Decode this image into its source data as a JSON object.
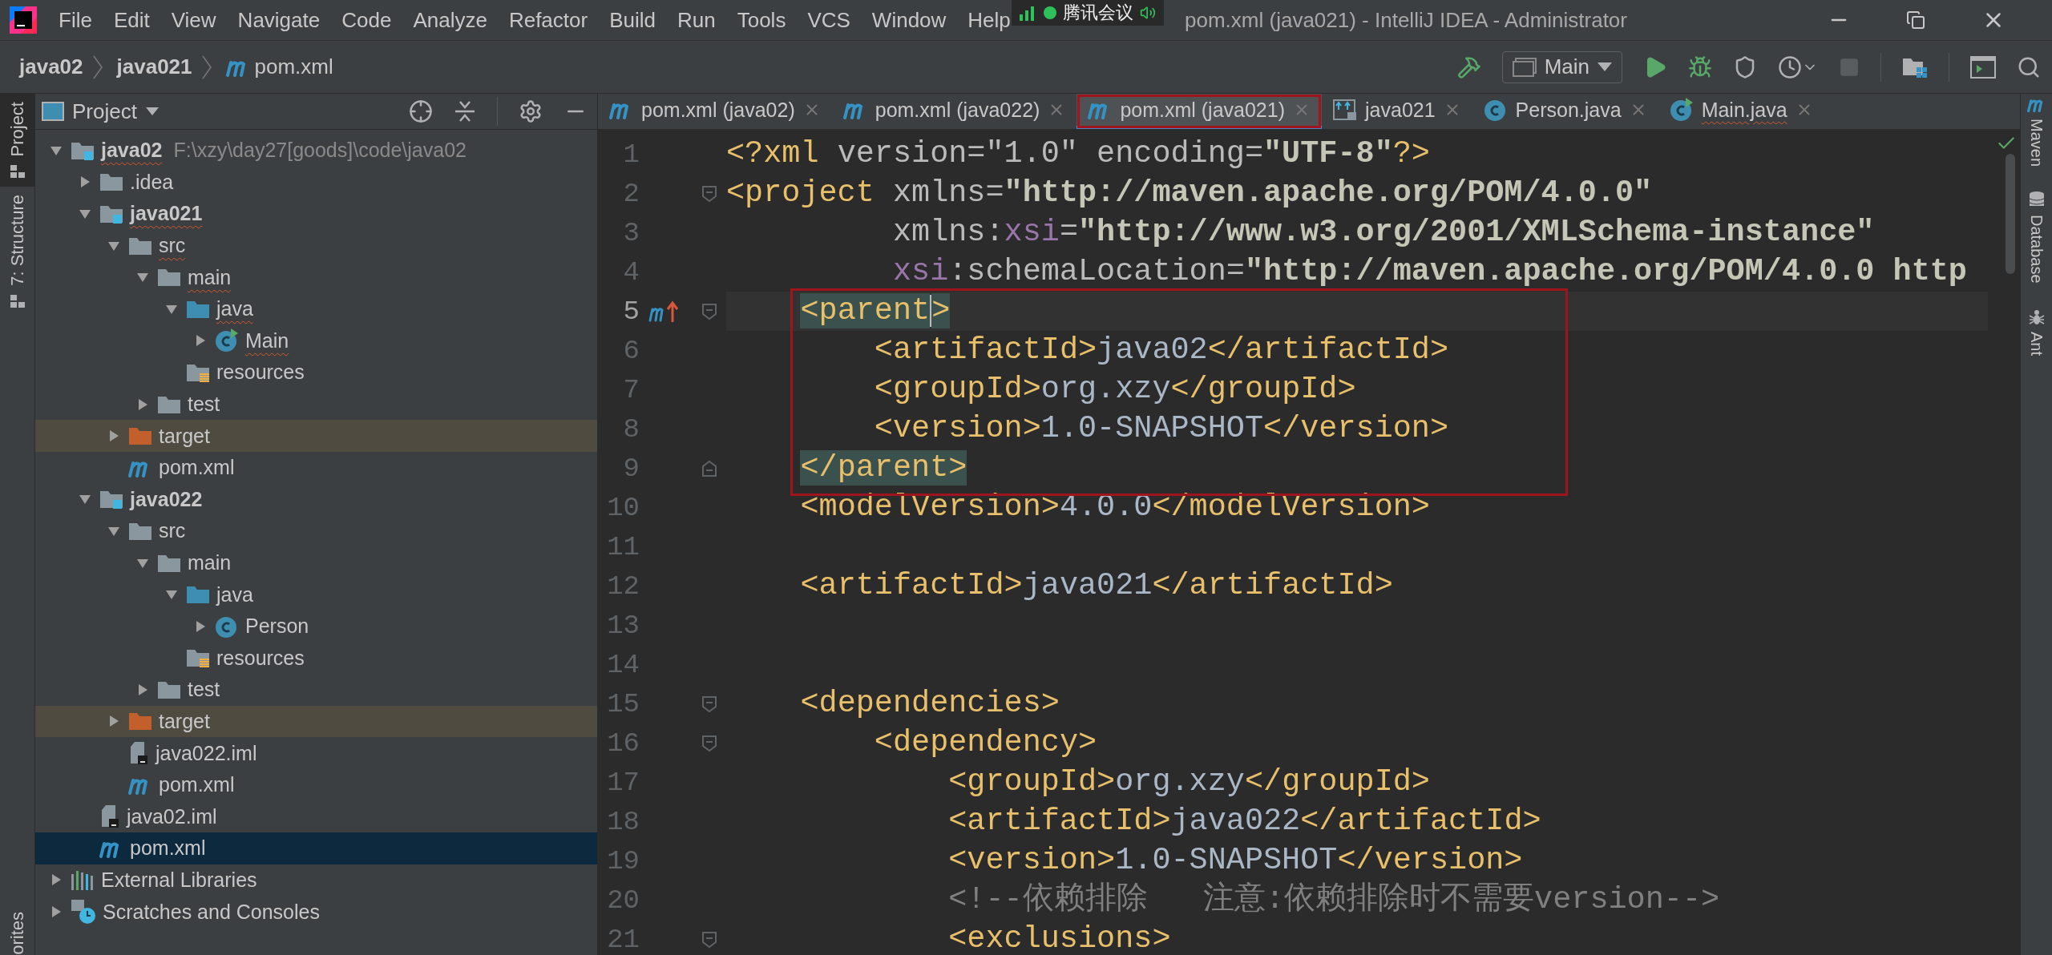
{
  "title_bar": {
    "menu": [
      "File",
      "Edit",
      "View",
      "Navigate",
      "Code",
      "Analyze",
      "Refactor",
      "Build",
      "Run",
      "Tools",
      "VCS",
      "Window",
      "Help"
    ],
    "title": "pom.xml (java021) - IntelliJ IDEA - Administrator"
  },
  "meeting_overlay": {
    "label": "腾讯会议"
  },
  "breadcrumbs": [
    {
      "label": "java02",
      "kind": "module"
    },
    {
      "label": "java021",
      "kind": "module"
    },
    {
      "label": "pom.xml",
      "kind": "maven"
    }
  ],
  "run_config": {
    "label": "Main"
  },
  "left_stripe": {
    "top": [
      {
        "label": "Project",
        "selected": true
      },
      {
        "label": "7: Structure",
        "selected": false
      }
    ],
    "bottom": [
      {
        "label": "orites",
        "selected": false
      }
    ]
  },
  "project_panel": {
    "title": "Project",
    "tree": [
      {
        "label": "java02",
        "kind": "module",
        "location": "F:\\xzy\\day27[goods]\\code\\java02",
        "expanded": true,
        "selected": false,
        "error": true,
        "children": [
          {
            "label": ".idea",
            "kind": "folder",
            "expanded": false,
            "selected": false,
            "error": false
          },
          {
            "label": "java021",
            "kind": "module",
            "expanded": true,
            "selected": false,
            "error": true,
            "children": [
              {
                "label": "src",
                "kind": "folder",
                "expanded": true,
                "selected": false,
                "error": true,
                "children": [
                  {
                    "label": "main",
                    "kind": "folder",
                    "expanded": true,
                    "selected": false,
                    "error": true,
                    "children": [
                      {
                        "label": "java",
                        "kind": "source",
                        "expanded": true,
                        "selected": false,
                        "error": true,
                        "children": [
                          {
                            "label": "Main",
                            "kind": "class-main",
                            "expanded": false,
                            "selected": false,
                            "error": true
                          }
                        ]
                      },
                      {
                        "label": "resources",
                        "kind": "resources",
                        "selected": false,
                        "error": false
                      }
                    ]
                  },
                  {
                    "label": "test",
                    "kind": "folder",
                    "expanded": false,
                    "selected": false,
                    "error": false
                  }
                ]
              },
              {
                "label": "target",
                "kind": "excluded",
                "expanded": false,
                "selected": false,
                "error": false
              },
              {
                "label": "pom.xml",
                "kind": "maven",
                "selected": false,
                "error": false
              }
            ]
          },
          {
            "label": "java022",
            "kind": "module",
            "expanded": true,
            "selected": false,
            "error": false,
            "children": [
              {
                "label": "src",
                "kind": "folder",
                "expanded": true,
                "selected": false,
                "error": false,
                "children": [
                  {
                    "label": "main",
                    "kind": "folder",
                    "expanded": true,
                    "selected": false,
                    "error": false,
                    "children": [
                      {
                        "label": "java",
                        "kind": "source",
                        "expanded": true,
                        "selected": false,
                        "error": false,
                        "children": [
                          {
                            "label": "Person",
                            "kind": "class",
                            "expanded": false,
                            "selected": false,
                            "error": false
                          }
                        ]
                      },
                      {
                        "label": "resources",
                        "kind": "resources",
                        "selected": false,
                        "error": false
                      }
                    ]
                  },
                  {
                    "label": "test",
                    "kind": "folder",
                    "expanded": false,
                    "selected": false,
                    "error": false
                  }
                ]
              },
              {
                "label": "target",
                "kind": "excluded",
                "expanded": false,
                "selected": false,
                "error": false
              },
              {
                "label": "java022.iml",
                "kind": "iml",
                "selected": false,
                "error": false
              },
              {
                "label": "pom.xml",
                "kind": "maven",
                "selected": false,
                "error": false
              }
            ]
          },
          {
            "label": "java02.iml",
            "kind": "iml",
            "selected": false,
            "error": false
          },
          {
            "label": "pom.xml",
            "kind": "maven",
            "selected": true,
            "error": false
          }
        ]
      },
      {
        "label": "External Libraries",
        "kind": "libraries",
        "expanded": false,
        "selected": false,
        "error": false
      },
      {
        "label": "Scratches and Consoles",
        "kind": "scratches",
        "expanded": false,
        "selected": false,
        "error": false
      }
    ]
  },
  "editor": {
    "tabs": [
      {
        "label": "pom.xml (java02)",
        "kind": "maven",
        "selected": false,
        "annotated": false,
        "error": false
      },
      {
        "label": "pom.xml (java022)",
        "kind": "maven",
        "selected": false,
        "annotated": false,
        "error": false
      },
      {
        "label": "pom.xml (java021)",
        "kind": "maven",
        "selected": true,
        "annotated": true,
        "error": false
      },
      {
        "label": "java021",
        "kind": "module",
        "selected": false,
        "annotated": false,
        "error": false
      },
      {
        "label": "Person.java",
        "kind": "class",
        "selected": false,
        "annotated": false,
        "error": false
      },
      {
        "label": "Main.java",
        "kind": "class-main",
        "selected": false,
        "annotated": false,
        "error": true
      }
    ],
    "lines": [
      {
        "number": "1",
        "current": false,
        "boxed": false,
        "tokens": [
          {
            "kind": "tag",
            "t": "<?xml "
          },
          {
            "kind": "attr",
            "t": "version=\"1.0\" encoding="
          },
          {
            "kind": "value",
            "t": "\"UTF-8\""
          },
          {
            "kind": "tag",
            "t": "?>"
          }
        ]
      },
      {
        "number": "2",
        "current": false,
        "boxed": false,
        "fold_start": true,
        "tokens": [
          {
            "kind": "tag",
            "t": "<project "
          },
          {
            "kind": "attr",
            "t": "xmlns="
          },
          {
            "kind": "value",
            "t": "\"http://maven.apache.org/POM/4.0.0\""
          }
        ]
      },
      {
        "number": "3",
        "current": false,
        "boxed": false,
        "tokens": [
          {
            "kind": "attr",
            "t": "         xmlns:"
          },
          {
            "kind": "ns",
            "t": "xsi"
          },
          {
            "kind": "attr",
            "t": "="
          },
          {
            "kind": "value",
            "t": "\"http://www.w3.org/2001/XMLSchema-instance\""
          }
        ]
      },
      {
        "number": "4",
        "current": false,
        "boxed": false,
        "tokens": [
          {
            "kind": "ns",
            "t": "         xsi"
          },
          {
            "kind": "attr",
            "t": ":schemaLocation="
          },
          {
            "kind": "value",
            "t": "\"http://maven.apache.org/POM/4.0.0 http"
          }
        ]
      },
      {
        "number": "5",
        "current": true,
        "boxed": true,
        "fold_start": true,
        "maven_override": true,
        "tokens": [
          {
            "kind": "match",
            "t": "    <parent"
          },
          {
            "kind": "caret"
          },
          {
            "kind": "match",
            "t": ">"
          }
        ]
      },
      {
        "number": "6",
        "current": false,
        "boxed": true,
        "tokens": [
          {
            "kind": "tag",
            "t": "        <artifactId>"
          },
          {
            "kind": "text",
            "t": "java02"
          },
          {
            "kind": "tag",
            "t": "</artifactId>"
          }
        ]
      },
      {
        "number": "7",
        "current": false,
        "boxed": true,
        "tokens": [
          {
            "kind": "tag",
            "t": "        <groupId>"
          },
          {
            "kind": "text",
            "t": "org.xzy"
          },
          {
            "kind": "tag",
            "t": "</groupId>"
          }
        ]
      },
      {
        "number": "8",
        "current": false,
        "boxed": true,
        "tokens": [
          {
            "kind": "tag",
            "t": "        <version>"
          },
          {
            "kind": "text",
            "t": "1.0-SNAPSHOT"
          },
          {
            "kind": "tag",
            "t": "</version>"
          }
        ]
      },
      {
        "number": "9",
        "current": false,
        "boxed": true,
        "fold_end": true,
        "tokens": [
          {
            "kind": "match",
            "t": "    </parent>"
          }
        ]
      },
      {
        "number": "10",
        "current": false,
        "boxed": false,
        "tokens": [
          {
            "kind": "tag",
            "t": "    <modelVersion>"
          },
          {
            "kind": "text",
            "t": "4.0.0"
          },
          {
            "kind": "tag",
            "t": "</modelVersion>"
          }
        ]
      },
      {
        "number": "11",
        "current": false,
        "boxed": false
      },
      {
        "number": "12",
        "current": false,
        "boxed": false,
        "tokens": [
          {
            "kind": "tag",
            "t": "    <artifactId>"
          },
          {
            "kind": "text",
            "t": "java021"
          },
          {
            "kind": "tag",
            "t": "</artifactId>"
          }
        ]
      },
      {
        "number": "13",
        "current": false,
        "boxed": false
      },
      {
        "number": "14",
        "current": false,
        "boxed": false
      },
      {
        "number": "15",
        "current": false,
        "boxed": false,
        "fold_start": true,
        "tokens": [
          {
            "kind": "tag",
            "t": "    <dependencies>"
          }
        ]
      },
      {
        "number": "16",
        "current": false,
        "boxed": false,
        "fold_start": true,
        "tokens": [
          {
            "kind": "tag",
            "t": "        <dependency>"
          }
        ]
      },
      {
        "number": "17",
        "current": false,
        "boxed": false,
        "tokens": [
          {
            "kind": "tag",
            "t": "            <groupId>"
          },
          {
            "kind": "text",
            "t": "org.xzy"
          },
          {
            "kind": "tag",
            "t": "</groupId>"
          }
        ]
      },
      {
        "number": "18",
        "current": false,
        "boxed": false,
        "tokens": [
          {
            "kind": "tag",
            "t": "            <artifactId>"
          },
          {
            "kind": "text",
            "t": "java022"
          },
          {
            "kind": "tag",
            "t": "</artifactId>"
          }
        ]
      },
      {
        "number": "19",
        "current": false,
        "boxed": false,
        "tokens": [
          {
            "kind": "tag",
            "t": "            <version>"
          },
          {
            "kind": "text",
            "t": "1.0-SNAPSHOT"
          },
          {
            "kind": "tag",
            "t": "</version>"
          }
        ]
      },
      {
        "number": "20",
        "current": false,
        "boxed": false,
        "tokens": [
          {
            "kind": "comment",
            "t": "            <!--依赖排除   注意:依赖排除时不需要version-->"
          }
        ]
      },
      {
        "number": "21",
        "current": false,
        "boxed": false,
        "fold_start": true,
        "tokens": [
          {
            "kind": "tag",
            "t": "            <exclusions>"
          }
        ]
      }
    ]
  },
  "right_stripe": [
    {
      "label": "Maven",
      "kind": "maven"
    },
    {
      "label": "Database",
      "kind": "database"
    },
    {
      "label": "Ant",
      "kind": "ant"
    }
  ]
}
